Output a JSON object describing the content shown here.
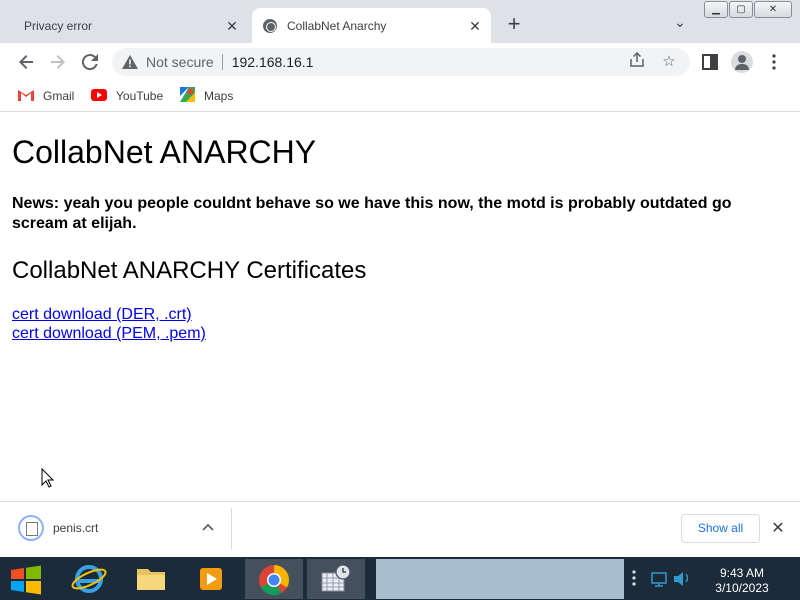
{
  "window": {
    "minimize_label": "▭",
    "maximize_label": "▢",
    "close_label": "✕"
  },
  "tabs": [
    {
      "title": "Privacy error",
      "active": false
    },
    {
      "title": "CollabNet Anarchy",
      "active": true
    }
  ],
  "toolbar": {
    "security_text": "Not secure",
    "url": "192.168.16.1"
  },
  "bookmarks": [
    {
      "label": "Gmail",
      "icon": "gmail-icon"
    },
    {
      "label": "YouTube",
      "icon": "youtube-icon"
    },
    {
      "label": "Maps",
      "icon": "maps-icon"
    }
  ],
  "page": {
    "title": "CollabNet ANARCHY",
    "news": "News: yeah you people couldnt behave so we have this now, the motd is probably outdated go scream at elijah.",
    "certs_heading": "CollabNet ANARCHY Certificates",
    "links": [
      {
        "label": "cert download (DER, .crt)"
      },
      {
        "label": "cert download (PEM, .pem)"
      }
    ]
  },
  "download_shelf": {
    "file_name": "penis.crt",
    "show_all_label": "Show all"
  },
  "taskbar": {
    "apps": [
      "start-button",
      "internet-explorer-icon",
      "file-explorer-icon",
      "media-player-icon",
      "chrome-icon",
      "calendar-clock-icon"
    ],
    "time": "9:43 AM",
    "date": "3/10/2023"
  },
  "colors": {
    "link": "#0000ee",
    "accent": "#1a73e8",
    "taskbar": "#1c2b3a",
    "tabstrip": "#dee1e6"
  }
}
